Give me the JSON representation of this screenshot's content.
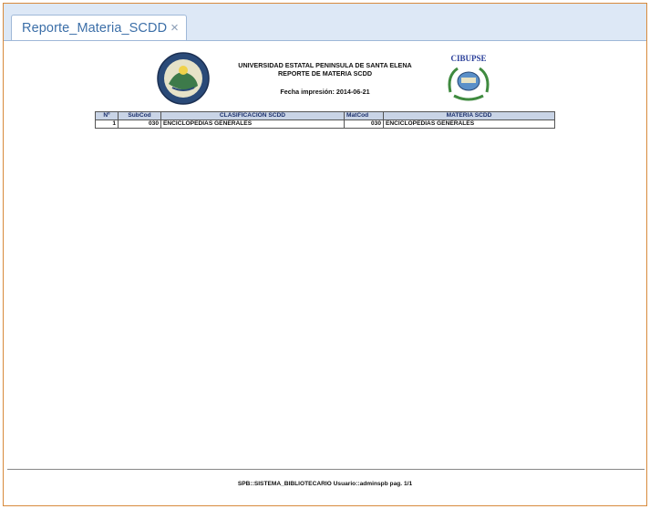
{
  "tab": {
    "title": "Reporte_Materia_SCDD",
    "close": "×"
  },
  "report": {
    "institution": "UNIVERSIDAD ESTATAL PENINSULA DE SANTA ELENA",
    "report_title": "REPORTE DE MATERIA SCDD",
    "print_date": "Fecha impresión: 2014-06-21",
    "right_logo_text": "CIBUPSE",
    "columns": [
      "Nº",
      "SubCod",
      "CLASIFICACIÓN SCDD",
      "MatCod",
      "MATERIA SCDD"
    ],
    "rows": [
      [
        "1",
        "030",
        "ENCICLOPEDIAS GENERALES",
        "030",
        "ENCICLOPEDIAS GENERALES"
      ]
    ],
    "footer": "SPB::SISTEMA_BIBLIOTECARIO Usuario::adminspb pag. 1/1"
  },
  "colors": {
    "frame_border": "#d88a3c",
    "tab_strip": "#dde8f6",
    "tab_text": "#3c6fa8",
    "header_fill": "#c9d4e6"
  }
}
